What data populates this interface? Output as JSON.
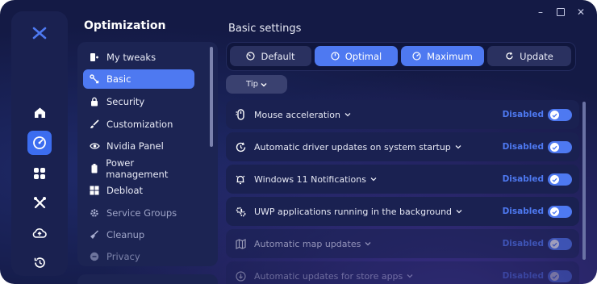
{
  "window": {
    "controls": [
      "minimize",
      "maximize",
      "close"
    ]
  },
  "rail": {
    "items": [
      {
        "name": "home-icon",
        "active": false
      },
      {
        "name": "speedometer-icon",
        "active": true
      },
      {
        "name": "apps-grid-icon",
        "active": false
      },
      {
        "name": "tools-icon",
        "active": false
      },
      {
        "name": "cloud-upload-icon",
        "active": false
      },
      {
        "name": "history-icon",
        "active": false
      }
    ]
  },
  "sidebar": {
    "title": "Optimization",
    "items": [
      {
        "label": "My tweaks",
        "icon": "tweaks-icon"
      },
      {
        "label": "Basic",
        "icon": "basic-icon",
        "active": true
      },
      {
        "label": "Security",
        "icon": "lock-icon"
      },
      {
        "label": "Customization",
        "icon": "brush-icon"
      },
      {
        "label": "Nvidia Panel",
        "icon": "nvidia-icon"
      },
      {
        "label": "Power management",
        "icon": "battery-icon"
      },
      {
        "label": "Debloat",
        "icon": "windows-icon"
      },
      {
        "label": "Service Groups",
        "icon": "gear-icon"
      },
      {
        "label": "Cleanup",
        "icon": "broom-icon"
      },
      {
        "label": "Privacy",
        "icon": "privacy-icon"
      }
    ]
  },
  "main": {
    "title": "Basic settings",
    "modes": [
      {
        "label": "Default",
        "icon": "gauge-low-icon"
      },
      {
        "label": "Optimal",
        "icon": "gauge-mid-icon",
        "active": true
      },
      {
        "label": "Maximum",
        "icon": "gauge-high-icon",
        "active": true
      },
      {
        "label": "Update",
        "icon": "refresh-icon"
      }
    ],
    "tip_label": "Tip",
    "settings": [
      {
        "label": "Mouse acceleration",
        "status": "Disabled",
        "icon": "mouse-icon"
      },
      {
        "label": "Automatic driver updates on system startup",
        "status": "Disabled",
        "icon": "update-icon"
      },
      {
        "label": "Windows 11 Notifications",
        "status": "Disabled",
        "icon": "bell-icon"
      },
      {
        "label": "UWP applications running in the background",
        "status": "Disabled",
        "icon": "apps-gear-icon"
      },
      {
        "label": "Automatic map updates",
        "status": "Disabled",
        "icon": "map-icon"
      },
      {
        "label": "Automatic updates for store apps",
        "status": "Disabled",
        "icon": "download-icon"
      }
    ]
  },
  "colors": {
    "accent": "#4e79f1",
    "background": "#141a45",
    "panel": "#1c2453"
  }
}
